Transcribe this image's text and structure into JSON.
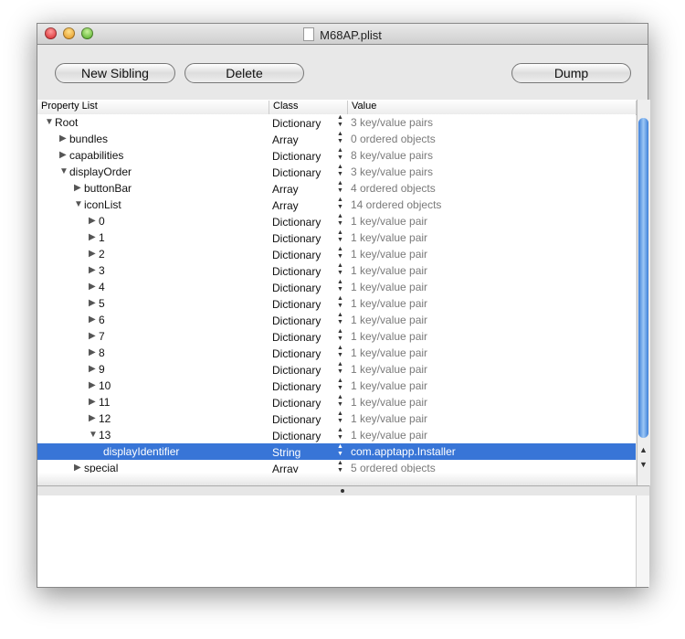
{
  "window": {
    "title": "M68AP.plist"
  },
  "toolbar": {
    "new_sibling": "New Sibling",
    "delete": "Delete",
    "dump": "Dump"
  },
  "columns": {
    "property": "Property List",
    "class": "Class",
    "value": "Value"
  },
  "rows": [
    {
      "name": "Root",
      "level": 0,
      "exp": "open",
      "cls": "Dictionary",
      "val": "3 key/value pairs"
    },
    {
      "name": "bundles",
      "level": 1,
      "exp": "closed",
      "cls": "Array",
      "val": "0 ordered objects"
    },
    {
      "name": "capabilities",
      "level": 1,
      "exp": "closed",
      "cls": "Dictionary",
      "val": "8 key/value pairs"
    },
    {
      "name": "displayOrder",
      "level": 1,
      "exp": "open",
      "cls": "Dictionary",
      "val": "3 key/value pairs"
    },
    {
      "name": "buttonBar",
      "level": 2,
      "exp": "closed",
      "cls": "Array",
      "val": "4 ordered objects"
    },
    {
      "name": "iconList",
      "level": 2,
      "exp": "open",
      "cls": "Array",
      "val": "14 ordered objects"
    },
    {
      "name": "0",
      "level": 3,
      "exp": "closed",
      "cls": "Dictionary",
      "val": "1 key/value pair"
    },
    {
      "name": "1",
      "level": 3,
      "exp": "closed",
      "cls": "Dictionary",
      "val": "1 key/value pair"
    },
    {
      "name": "2",
      "level": 3,
      "exp": "closed",
      "cls": "Dictionary",
      "val": "1 key/value pair"
    },
    {
      "name": "3",
      "level": 3,
      "exp": "closed",
      "cls": "Dictionary",
      "val": "1 key/value pair"
    },
    {
      "name": "4",
      "level": 3,
      "exp": "closed",
      "cls": "Dictionary",
      "val": "1 key/value pair"
    },
    {
      "name": "5",
      "level": 3,
      "exp": "closed",
      "cls": "Dictionary",
      "val": "1 key/value pair"
    },
    {
      "name": "6",
      "level": 3,
      "exp": "closed",
      "cls": "Dictionary",
      "val": "1 key/value pair"
    },
    {
      "name": "7",
      "level": 3,
      "exp": "closed",
      "cls": "Dictionary",
      "val": "1 key/value pair"
    },
    {
      "name": "8",
      "level": 3,
      "exp": "closed",
      "cls": "Dictionary",
      "val": "1 key/value pair"
    },
    {
      "name": "9",
      "level": 3,
      "exp": "closed",
      "cls": "Dictionary",
      "val": "1 key/value pair"
    },
    {
      "name": "10",
      "level": 3,
      "exp": "closed",
      "cls": "Dictionary",
      "val": "1 key/value pair"
    },
    {
      "name": "11",
      "level": 3,
      "exp": "closed",
      "cls": "Dictionary",
      "val": "1 key/value pair"
    },
    {
      "name": "12",
      "level": 3,
      "exp": "closed",
      "cls": "Dictionary",
      "val": "1 key/value pair"
    },
    {
      "name": "13",
      "level": 3,
      "exp": "open",
      "cls": "Dictionary",
      "val": "1 key/value pair"
    },
    {
      "name": "displayIdentifier",
      "level": 4,
      "exp": "none",
      "cls": "String",
      "val": "com.apptapp.Installer",
      "selected": true
    },
    {
      "name": "special",
      "level": 2,
      "exp": "closed",
      "cls": "Array",
      "val": "5 ordered objects"
    }
  ]
}
